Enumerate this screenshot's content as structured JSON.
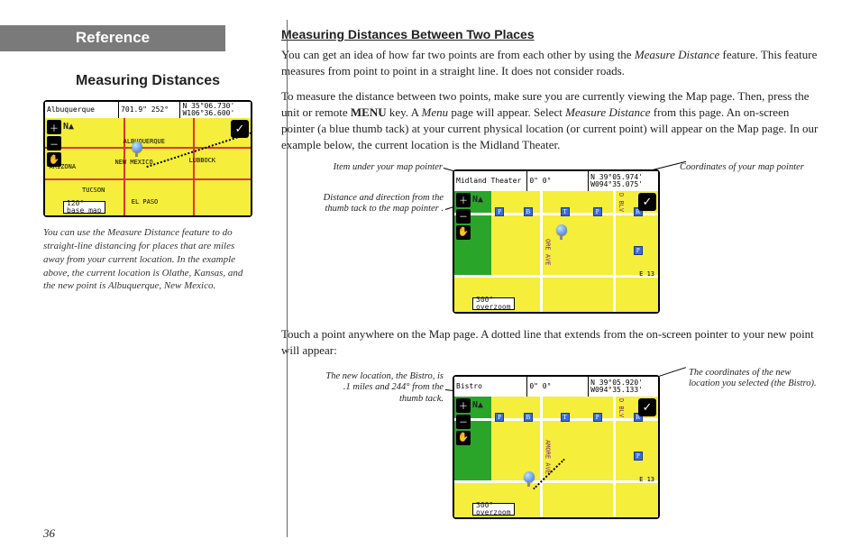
{
  "left": {
    "banner": "Reference",
    "subheading": "Measuring Distances",
    "gps1": {
      "title": "Albuquerque",
      "distdir": "701.9\"  252°",
      "coords": "N 35°06.730'\nW106°36.600'",
      "scale": "120°",
      "scalelabel": "base map",
      "north": "N▲",
      "places": {
        "alb": "ALBUQUERQUE",
        "nm": "NEW MEXICO",
        "az": "ARIZONA",
        "lub": "LUBBOCK",
        "tuc": "TUCSON",
        "elp": "EL PASO"
      }
    },
    "caption": "You can use the Measure Distance feature to do straight-line distancing for places that are miles away from your current location. In the example above, the current location is Olathe, Kansas, and the new point is Albuquerque, New Mexico."
  },
  "right": {
    "title": "Measuring Distances Between Two Places",
    "p1a": "You can get an idea of how far two points are from each other by using the ",
    "p1em": "Measure Distance",
    "p1b": " feature. This feature measures from point to point in a straight line. It does not consider roads.",
    "p2a": "To measure the distance between two points, make sure you are currently viewing the Map page. Then, press the unit or remote ",
    "p2key": "MENU",
    "p2b": " key. A ",
    "p2em1": "Menu",
    "p2c": " page will appear. Select ",
    "p2em2": "Measure Distance",
    "p2d": " from this page. An on-screen pointer (a blue thumb tack) at your current physical location (or current point) will appear on the Map page. In our example below, the current location is the Midland Theater.",
    "fig1": {
      "c1": "Item under your map pointer",
      "c2": "Distance and direction from the thumb tack to the map pointer .",
      "c3": "Coordinates of your map pointer",
      "gps": {
        "title": "Midland Theater",
        "distdir": "0\"      0°",
        "coords": "N 39°05.974'\nW094°35.075'",
        "scale": "300°",
        "scalelabel": "overzoom",
        "north": "N▲",
        "streets": {
          "s1": "ORE AVE",
          "s2": "D BLV"
        },
        "rt": "E 13"
      }
    },
    "p3": "Touch a point anywhere on the Map page. A dotted line that extends from the on-screen pointer to your new point will appear:",
    "fig2": {
      "c1": "The new location, the Bistro, is .1 miles and 244° from the thumb tack.",
      "c2": "The coordinates of the new location you selected (the Bistro).",
      "gps": {
        "title": "Bistro",
        "distdir": "0\"      0°",
        "coords": "N 39°05.920'\nW094°35.133'",
        "scale": "300°",
        "scalelabel": "overzoom",
        "north": "N▲",
        "streets": {
          "s1": "AMORE AVE",
          "s2": "D BLV"
        },
        "rt": "E 13"
      }
    }
  },
  "pagenum": "36"
}
